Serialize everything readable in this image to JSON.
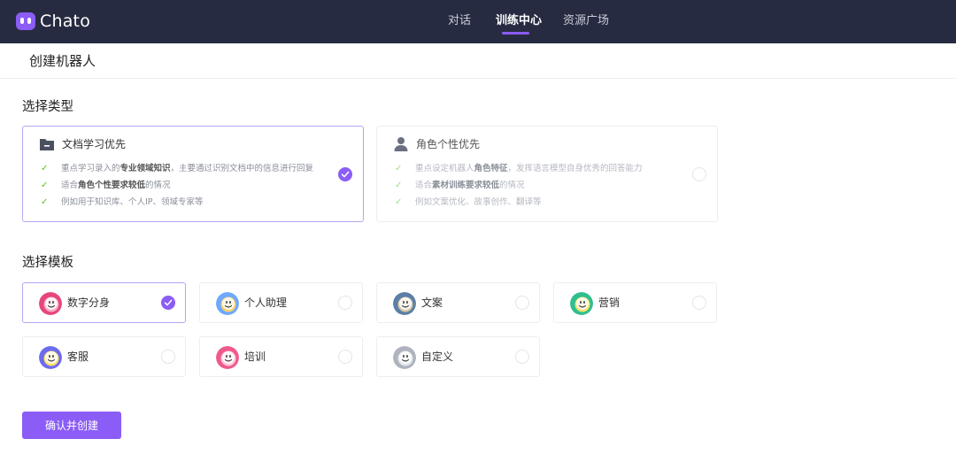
{
  "app": {
    "name": "Chato"
  },
  "nav": {
    "items": [
      {
        "label": "对话",
        "active": false
      },
      {
        "label": "训练中心",
        "active": true
      },
      {
        "label": "资源广场",
        "active": false
      }
    ]
  },
  "page": {
    "title": "创建机器人"
  },
  "type_section": {
    "title": "选择类型",
    "cards": [
      {
        "title": "文档学习优先",
        "icon": "folder-icon",
        "selected": true,
        "bullets": [
          {
            "pre": "重点学习录入的",
            "bold": "专业领域知识",
            "post": "，主要通过识别文档中的信息进行回复"
          },
          {
            "pre": "适合",
            "bold": "角色个性要求较低",
            "post": "的情况"
          },
          {
            "pre": "例如用于知识库、个人IP、领域专家等",
            "bold": "",
            "post": ""
          }
        ]
      },
      {
        "title": "角色个性优先",
        "icon": "person-icon",
        "selected": false,
        "bullets": [
          {
            "pre": "重点设定机器人",
            "bold": "角色特征",
            "post": "，发挥语言模型自身优秀的回答能力"
          },
          {
            "pre": "适合",
            "bold": "素材训练要求较低",
            "post": "的情况"
          },
          {
            "pre": "例如文案优化、故事创作、翻译等",
            "bold": "",
            "post": ""
          }
        ]
      }
    ]
  },
  "template_section": {
    "title": "选择模板",
    "templates": [
      {
        "label": "数字分身",
        "selected": true,
        "colors": [
          "#e8457f",
          "#f7a8c4"
        ]
      },
      {
        "label": "个人助理",
        "selected": false,
        "colors": [
          "#6fa8ff",
          "#ffd166"
        ]
      },
      {
        "label": "文案",
        "selected": false,
        "colors": [
          "#5b7fa6",
          "#d9c8a8"
        ]
      },
      {
        "label": "营销",
        "selected": false,
        "colors": [
          "#2fbf8f",
          "#f7e06a"
        ]
      },
      {
        "label": "客服",
        "selected": false,
        "colors": [
          "#6c6cf0",
          "#ffe066"
        ]
      },
      {
        "label": "培训",
        "selected": false,
        "colors": [
          "#ef5a8c",
          "#ffc7d9"
        ]
      },
      {
        "label": "自定义",
        "selected": false,
        "colors": [
          "#aeb3bd",
          "#e4e6ea"
        ]
      }
    ]
  },
  "actions": {
    "create_label": "确认并创建"
  },
  "colors": {
    "accent": "#8b5cf6",
    "nav_bg": "#272b41",
    "check": "#52c41a"
  }
}
